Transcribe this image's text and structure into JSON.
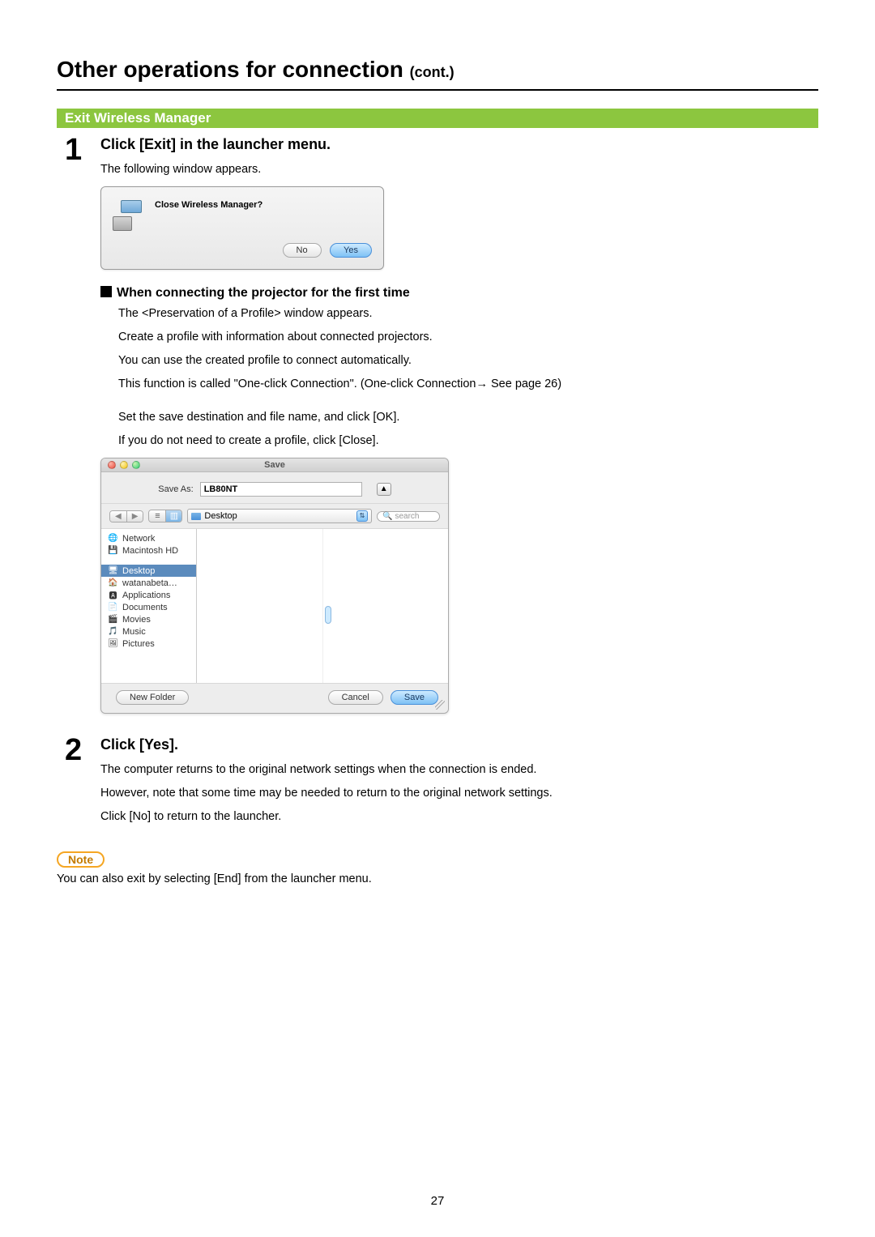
{
  "page": {
    "title_main": "Other operations for connection",
    "title_suffix": "(cont.)",
    "number": "27"
  },
  "section": {
    "bar": "Exit Wireless Manager"
  },
  "step1": {
    "num": "1",
    "heading": "Click [Exit] in the launcher menu.",
    "line1": "The following window appears.",
    "dialog": {
      "message": "Close Wireless Manager?",
      "no": "No",
      "yes": "Yes"
    },
    "sub_heading": "When connecting the projector for the first time",
    "sub_lines": {
      "a": "The <Preservation of a  Profile> window appears.",
      "b": "Create a profile with information about connected projectors.",
      "c": "You can use the created profile to connect automatically.",
      "d": "This function is called \"One-click Connection\". (One-click Connection→ See page 26)",
      "e": "Set the save destination and file name, and click [OK].",
      "f": "If you do not need to create a profile, click [Close]."
    },
    "save_sheet": {
      "title": "Save",
      "save_as_label": "Save As:",
      "save_as_value": "LB80NT",
      "location": "Desktop",
      "search_placeholder": "search",
      "sidebar": {
        "s0": "Network",
        "s1": "Macintosh HD",
        "s2": "Desktop",
        "s3": "watanabeta…",
        "s4": "Applications",
        "s5": "Documents",
        "s6": "Movies",
        "s7": "Music",
        "s8": "Pictures"
      },
      "new_folder": "New Folder",
      "cancel": "Cancel",
      "save": "Save"
    }
  },
  "step2": {
    "num": "2",
    "heading": "Click [Yes].",
    "line1": "The computer returns to the original network settings when the connection is ended.",
    "line2": "However, note that some time may be needed to return to the original network settings.",
    "line3": "Click [No] to return to the launcher."
  },
  "note": {
    "label": "Note",
    "text": "You can also exit by selecting [End] from the launcher menu."
  }
}
